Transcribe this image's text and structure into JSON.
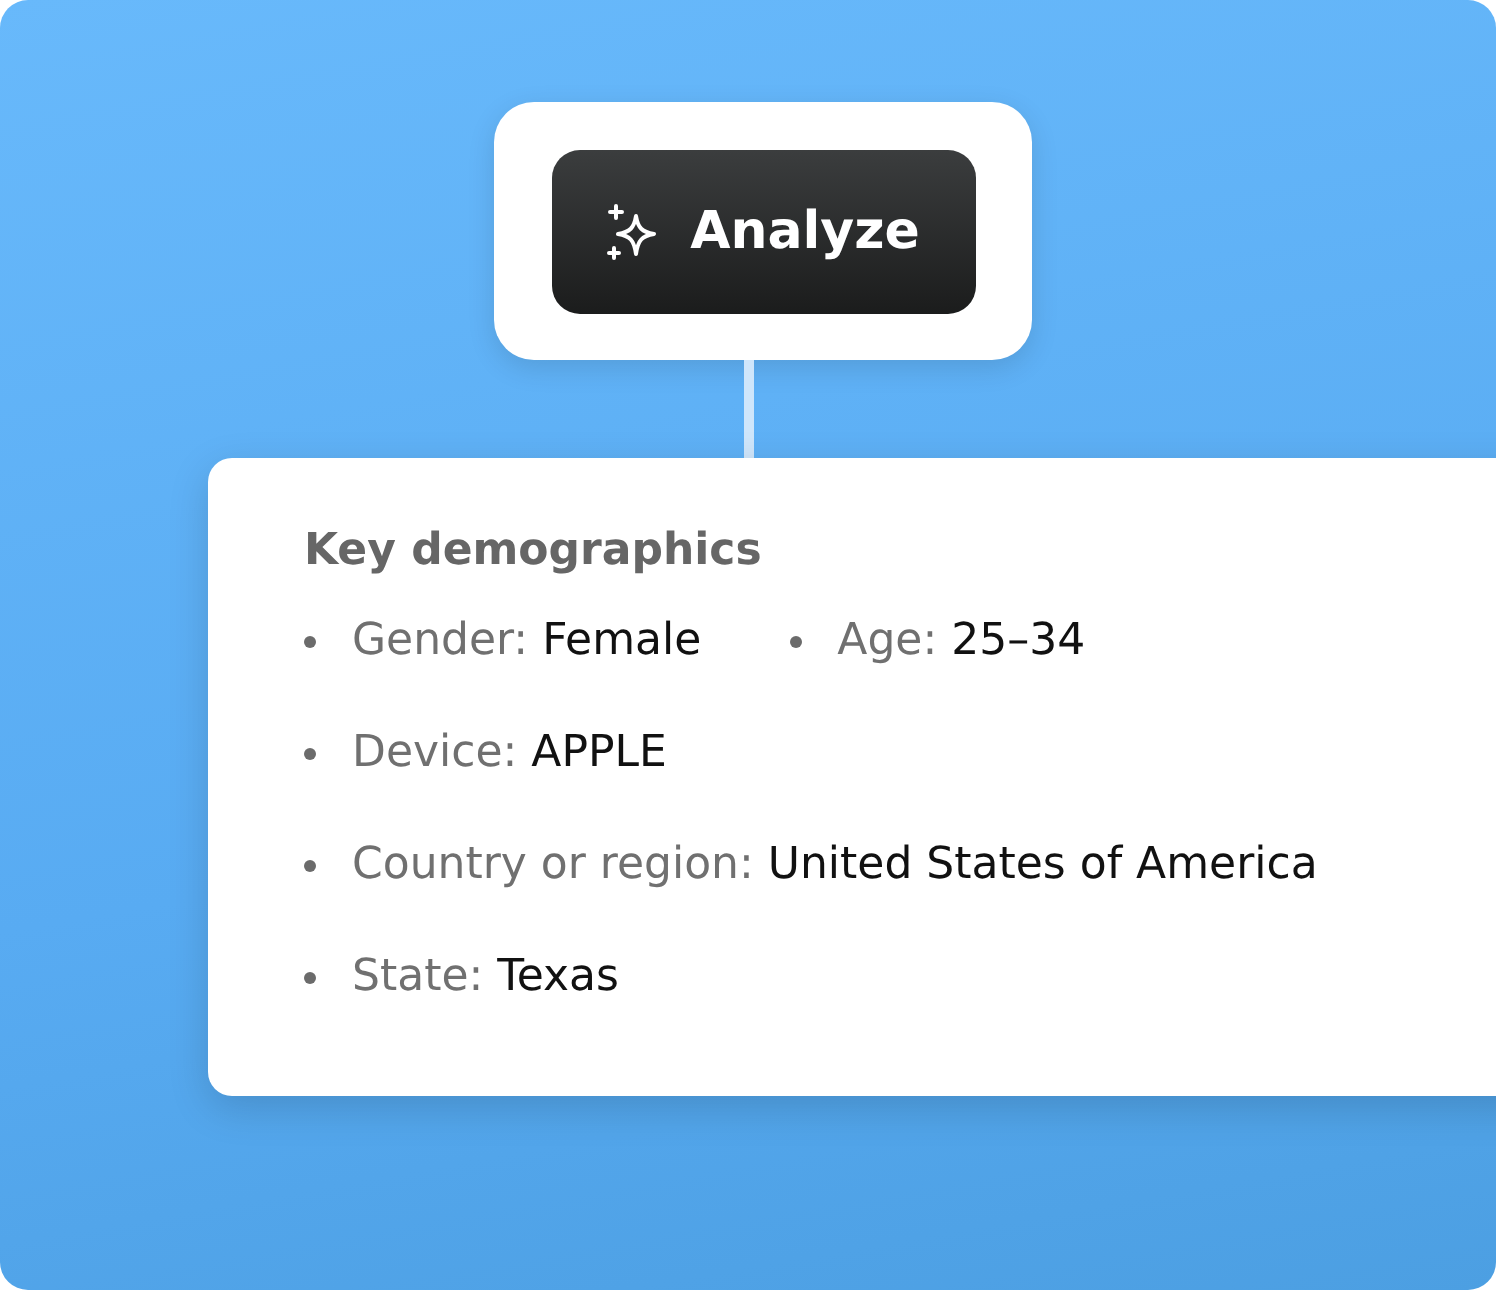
{
  "analyze_button": {
    "label": "Analyze"
  },
  "demographics": {
    "title": "Key demographics",
    "rows": [
      {
        "items": [
          {
            "label": "Gender:",
            "value": "Female"
          },
          {
            "label": "Age:",
            "value": "25–34"
          }
        ]
      },
      {
        "items": [
          {
            "label": "Device:",
            "value": "APPLE"
          }
        ]
      },
      {
        "items": [
          {
            "label": "Country or region:",
            "value": "United States of America"
          }
        ]
      },
      {
        "items": [
          {
            "label": "State:",
            "value": "Texas"
          }
        ]
      }
    ]
  }
}
